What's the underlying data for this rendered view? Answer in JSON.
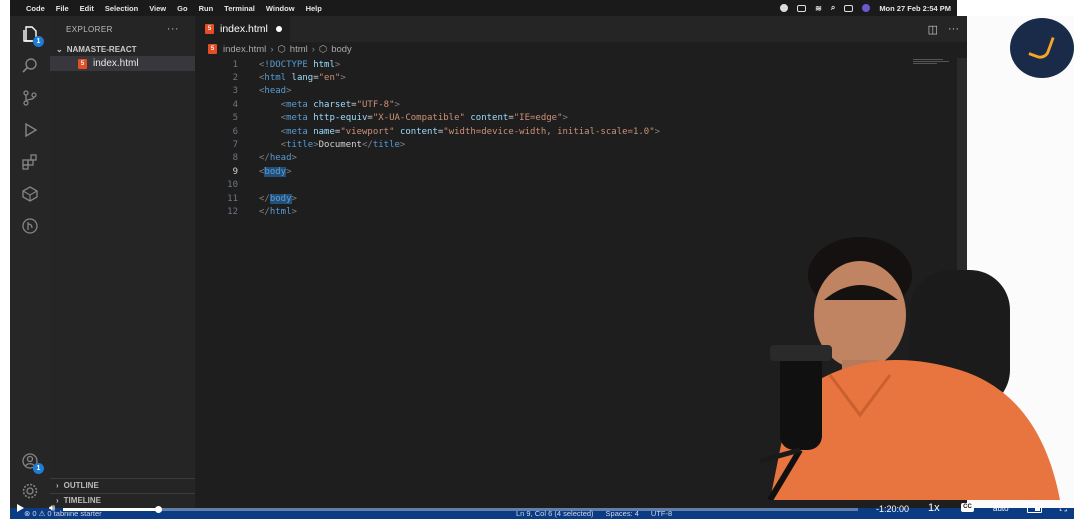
{
  "menubar": {
    "app": "Code",
    "items": [
      "File",
      "Edit",
      "Selection",
      "View",
      "Go",
      "Run",
      "Terminal",
      "Window",
      "Help"
    ],
    "datetime": "Mon 27 Feb  2:54 PM"
  },
  "activity_bar": {
    "explorer_badge": "1",
    "accounts_badge": "1"
  },
  "sidebar": {
    "title": "EXPLORER",
    "folder": "NAMASTE-REACT",
    "file": "index.html",
    "outline": "OUTLINE",
    "timeline": "TIMELINE"
  },
  "editor": {
    "tab": "index.html",
    "breadcrumb": [
      "index.html",
      "html",
      "body"
    ],
    "line_numbers": [
      "1",
      "2",
      "3",
      "4",
      "5",
      "6",
      "7",
      "8",
      "9",
      "10",
      "11",
      "12"
    ],
    "lines": [
      "<!DOCTYPE html>",
      "<html lang=\"en\">",
      "<head>",
      "    <meta charset=\"UTF-8\">",
      "    <meta http-equiv=\"X-UA-Compatible\" content=\"IE=edge\">",
      "    <meta name=\"viewport\" content=\"width=device-width, initial-scale=1.0\">",
      "    <title>Document</title>",
      "</head>",
      "<body>",
      "",
      "</body>",
      "</html>"
    ]
  },
  "statusbar": {
    "left": "⊗ 0 ⚠ 0    tabnine starter",
    "position": "Ln 9, Col 6 (4 selected)",
    "spaces": "Spaces: 4",
    "encoding": "UTF-8"
  },
  "video": {
    "time": "-1:20:00",
    "speed": "1x",
    "cc": "CC",
    "quality": "auto",
    "progress": 0.12
  }
}
